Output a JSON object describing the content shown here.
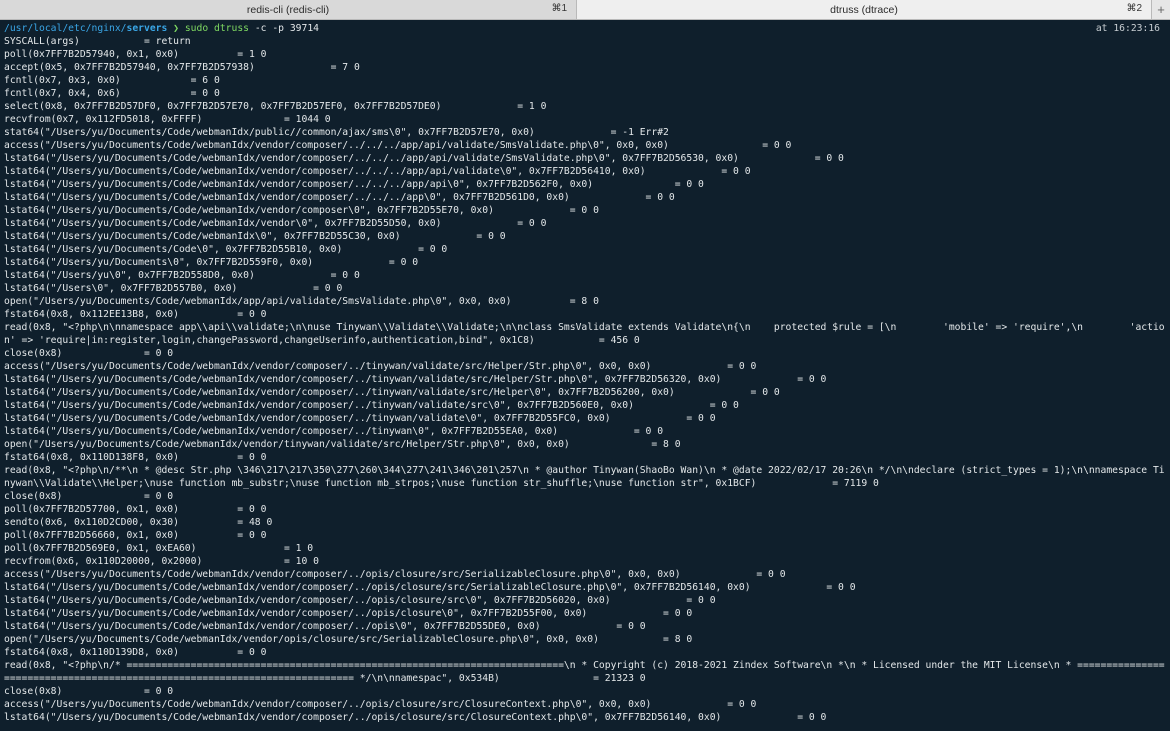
{
  "tabs": [
    {
      "label": "redis-cli (redis-cli)",
      "shortcut": "⌘1"
    },
    {
      "label": "dtruss (dtrace)",
      "shortcut": "⌘2"
    }
  ],
  "new_tab_glyph": "+",
  "prompt": {
    "path_prefix": "/usr/local/etc/nginx/",
    "path_dir": "servers",
    "arrow": "❯",
    "command": "sudo dtruss",
    "args": "-c -p 39714",
    "time": "at 16:23:16"
  },
  "output": [
    "SYSCALL(args)           = return",
    "poll(0x7FF7B2D57940, 0x1, 0x0)          = 1 0",
    "accept(0x5, 0x7FF7B2D57940, 0x7FF7B2D57938)             = 7 0",
    "fcntl(0x7, 0x3, 0x0)            = 6 0",
    "fcntl(0x7, 0x4, 0x6)            = 0 0",
    "select(0x8, 0x7FF7B2D57DF0, 0x7FF7B2D57E70, 0x7FF7B2D57EF0, 0x7FF7B2D57DE0)             = 1 0",
    "recvfrom(0x7, 0x112FD5018, 0xFFFF)              = 1044 0",
    "stat64(\"/Users/yu/Documents/Code/webmanIdx/public//common/ajax/sms\\0\", 0x7FF7B2D57E70, 0x0)             = -1 Err#2",
    "access(\"/Users/yu/Documents/Code/webmanIdx/vendor/composer/../../../app/api/validate/SmsValidate.php\\0\", 0x0, 0x0)                = 0 0",
    "lstat64(\"/Users/yu/Documents/Code/webmanIdx/vendor/composer/../../../app/api/validate/SmsValidate.php\\0\", 0x7FF7B2D56530, 0x0)             = 0 0",
    "lstat64(\"/Users/yu/Documents/Code/webmanIdx/vendor/composer/../../../app/api/validate\\0\", 0x7FF7B2D56410, 0x0)             = 0 0",
    "lstat64(\"/Users/yu/Documents/Code/webmanIdx/vendor/composer/../../../app/api\\0\", 0x7FF7B2D562F0, 0x0)              = 0 0",
    "lstat64(\"/Users/yu/Documents/Code/webmanIdx/vendor/composer/../../../app\\0\", 0x7FF7B2D561D0, 0x0)             = 0 0",
    "lstat64(\"/Users/yu/Documents/Code/webmanIdx/vendor/composer\\0\", 0x7FF7B2D55E70, 0x0)             = 0 0",
    "lstat64(\"/Users/yu/Documents/Code/webmanIdx/vendor\\0\", 0x7FF7B2D55D50, 0x0)             = 0 0",
    "lstat64(\"/Users/yu/Documents/Code/webmanIdx\\0\", 0x7FF7B2D55C30, 0x0)             = 0 0",
    "lstat64(\"/Users/yu/Documents/Code\\0\", 0x7FF7B2D55B10, 0x0)             = 0 0",
    "lstat64(\"/Users/yu/Documents\\0\", 0x7FF7B2D559F0, 0x0)             = 0 0",
    "lstat64(\"/Users/yu\\0\", 0x7FF7B2D558D0, 0x0)             = 0 0",
    "lstat64(\"/Users\\0\", 0x7FF7B2D557B0, 0x0)             = 0 0",
    "open(\"/Users/yu/Documents/Code/webmanIdx/app/api/validate/SmsValidate.php\\0\", 0x0, 0x0)          = 8 0",
    "fstat64(0x8, 0x112EE13B8, 0x0)          = 0 0",
    "read(0x8, \"<?php\\n\\nnamespace app\\\\api\\\\validate;\\n\\nuse Tinywan\\\\Validate\\\\Validate;\\n\\nclass SmsValidate extends Validate\\n{\\n    protected $rule = [\\n        'mobile' => 'require',\\n        'action' => 'require|in:register,login,changePassword,changeUserinfo,authentication,bind\", 0x1C8)           = 456 0",
    "close(0x8)              = 0 0",
    "access(\"/Users/yu/Documents/Code/webmanIdx/vendor/composer/../tinywan/validate/src/Helper/Str.php\\0\", 0x0, 0x0)             = 0 0",
    "lstat64(\"/Users/yu/Documents/Code/webmanIdx/vendor/composer/../tinywan/validate/src/Helper/Str.php\\0\", 0x7FF7B2D56320, 0x0)             = 0 0",
    "lstat64(\"/Users/yu/Documents/Code/webmanIdx/vendor/composer/../tinywan/validate/src/Helper\\0\", 0x7FF7B2D56200, 0x0)             = 0 0",
    "lstat64(\"/Users/yu/Documents/Code/webmanIdx/vendor/composer/../tinywan/validate/src\\0\", 0x7FF7B2D560E0, 0x0)             = 0 0",
    "lstat64(\"/Users/yu/Documents/Code/webmanIdx/vendor/composer/../tinywan/validate\\0\", 0x7FF7B2D55FC0, 0x0)             = 0 0",
    "lstat64(\"/Users/yu/Documents/Code/webmanIdx/vendor/composer/../tinywan\\0\", 0x7FF7B2D55EA0, 0x0)             = 0 0",
    "open(\"/Users/yu/Documents/Code/webmanIdx/vendor/tinywan/validate/src/Helper/Str.php\\0\", 0x0, 0x0)              = 8 0",
    "fstat64(0x8, 0x110D138F8, 0x0)          = 0 0",
    "read(0x8, \"<?php\\n/**\\n * @desc Str.php \\346\\217\\217\\350\\277\\260\\344\\277\\241\\346\\201\\257\\n * @author Tinywan(ShaoBo Wan)\\n * @date 2022/02/17 20:26\\n */\\n\\ndeclare (strict_types = 1);\\n\\nnamespace Tinywan\\\\Validate\\\\Helper;\\nuse function mb_substr;\\nuse function mb_strpos;\\nuse function str_shuffle;\\nuse function str\", 0x1BCF)             = 7119 0",
    "close(0x8)              = 0 0",
    "poll(0x7FF7B2D57700, 0x1, 0x0)          = 0 0",
    "sendto(0x6, 0x110D2CD00, 0x30)          = 48 0",
    "poll(0x7FF7B2D56660, 0x1, 0x0)          = 0 0",
    "poll(0x7FF7B2D569E0, 0x1, 0xEA60)               = 1 0",
    "recvfrom(0x6, 0x110D20000, 0x2000)              = 10 0",
    "access(\"/Users/yu/Documents/Code/webmanIdx/vendor/composer/../opis/closure/src/SerializableClosure.php\\0\", 0x0, 0x0)             = 0 0",
    "lstat64(\"/Users/yu/Documents/Code/webmanIdx/vendor/composer/../opis/closure/src/SerializableClosure.php\\0\", 0x7FF7B2D56140, 0x0)             = 0 0",
    "lstat64(\"/Users/yu/Documents/Code/webmanIdx/vendor/composer/../opis/closure/src\\0\", 0x7FF7B2D56020, 0x0)             = 0 0",
    "lstat64(\"/Users/yu/Documents/Code/webmanIdx/vendor/composer/../opis/closure\\0\", 0x7FF7B2D55F00, 0x0)             = 0 0",
    "lstat64(\"/Users/yu/Documents/Code/webmanIdx/vendor/composer/../opis\\0\", 0x7FF7B2D55DE0, 0x0)             = 0 0",
    "open(\"/Users/yu/Documents/Code/webmanIdx/vendor/opis/closure/src/SerializableClosure.php\\0\", 0x0, 0x0)           = 8 0",
    "fstat64(0x8, 0x110D139D8, 0x0)          = 0 0",
    "read(0x8, \"<?php\\n/* ===========================================================================\\n * Copyright (c) 2018-2021 Zindex Software\\n *\\n * Licensed under the MIT License\\n * =========================================================================== */\\n\\nnamespac\", 0x534B)                = 21323 0",
    "close(0x8)              = 0 0",
    "access(\"/Users/yu/Documents/Code/webmanIdx/vendor/composer/../opis/closure/src/ClosureContext.php\\0\", 0x0, 0x0)             = 0 0",
    "lstat64(\"/Users/yu/Documents/Code/webmanIdx/vendor/composer/../opis/closure/src/ClosureContext.php\\0\", 0x7FF7B2D56140, 0x0)             = 0 0"
  ]
}
